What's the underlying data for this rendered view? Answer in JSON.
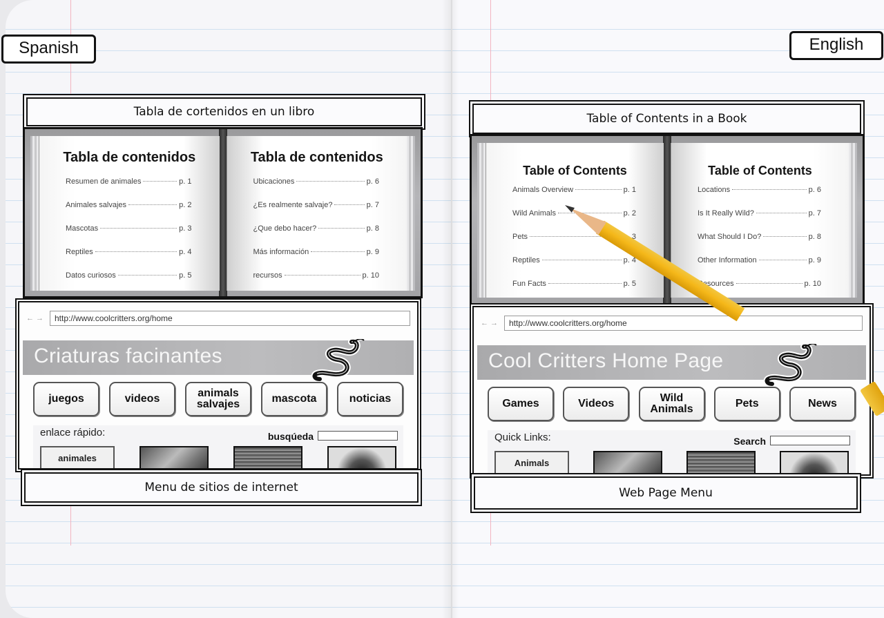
{
  "labels": {
    "left": "Spanish",
    "right": "English"
  },
  "spanish": {
    "toc_card_title": "Tabla de cortenidos en un libro",
    "book": {
      "left_heading": "Tabla de contenidos",
      "right_heading": "Tabla de contenidos",
      "left_entries": [
        {
          "title": "Resumen de animales",
          "page": "p. 1"
        },
        {
          "title": "Animales salvajes",
          "page": "p. 2"
        },
        {
          "title": "Mascotas",
          "page": "p. 3"
        },
        {
          "title": "Reptiles",
          "page": "p. 4"
        },
        {
          "title": "Datos curiosos",
          "page": "p. 5"
        }
      ],
      "right_entries": [
        {
          "title": "Ubicaciones",
          "page": "p. 6"
        },
        {
          "title": "¿Es realmente salvaje?",
          "page": "p. 7"
        },
        {
          "title": "¿Que debo hacer?",
          "page": "p. 8"
        },
        {
          "title": "Más información",
          "page": "p. 9"
        },
        {
          "title": "recursos",
          "page": "p. 10"
        }
      ]
    },
    "website": {
      "nav_arrows": "← →",
      "url": "http://www.coolcritters.org/home",
      "site_title": "Criaturas facinantes",
      "nav_buttons": [
        "juegos",
        "videos",
        "animals salvajes",
        "mascota",
        "noticias"
      ],
      "quick_links_label": "enlace rápido:",
      "search_label": "busqúeda",
      "quick_link_tile": "animales"
    },
    "web_card_title": "Menu de sitios de internet"
  },
  "english": {
    "toc_card_title": "Table of Contents in a Book",
    "book": {
      "left_heading": "Table of Contents",
      "right_heading": "Table of Contents",
      "left_entries": [
        {
          "title": "Animals Overview",
          "page": "p. 1"
        },
        {
          "title": "Wild Animals",
          "page": "p. 2"
        },
        {
          "title": "Pets",
          "page": "p. 3"
        },
        {
          "title": "Reptiles",
          "page": "p. 4"
        },
        {
          "title": "Fun Facts",
          "page": "p. 5"
        }
      ],
      "right_entries": [
        {
          "title": "Locations",
          "page": "p. 6"
        },
        {
          "title": "Is It Really Wild?",
          "page": "p. 7"
        },
        {
          "title": "What Should I Do?",
          "page": "p. 8"
        },
        {
          "title": "Other Information",
          "page": "p. 9"
        },
        {
          "title": "Resources",
          "page": "p. 10"
        }
      ]
    },
    "website": {
      "nav_arrows": "← →",
      "url": "http://www.coolcritters.org/home",
      "site_title": "Cool Critters Home Page",
      "nav_buttons": [
        "Games",
        "Videos",
        "Wild Animals",
        "Pets",
        "News"
      ],
      "quick_links_label": "Quick Links:",
      "search_label": "Search",
      "quick_link_tile": "Animals"
    },
    "web_card_title": "Web Page Menu"
  },
  "colors": {
    "pencil": "#f5b81a",
    "ruled_line": "#cfe0f0",
    "margin_line": "#f2b4c0",
    "banner_gray": "#b0b0b2"
  }
}
